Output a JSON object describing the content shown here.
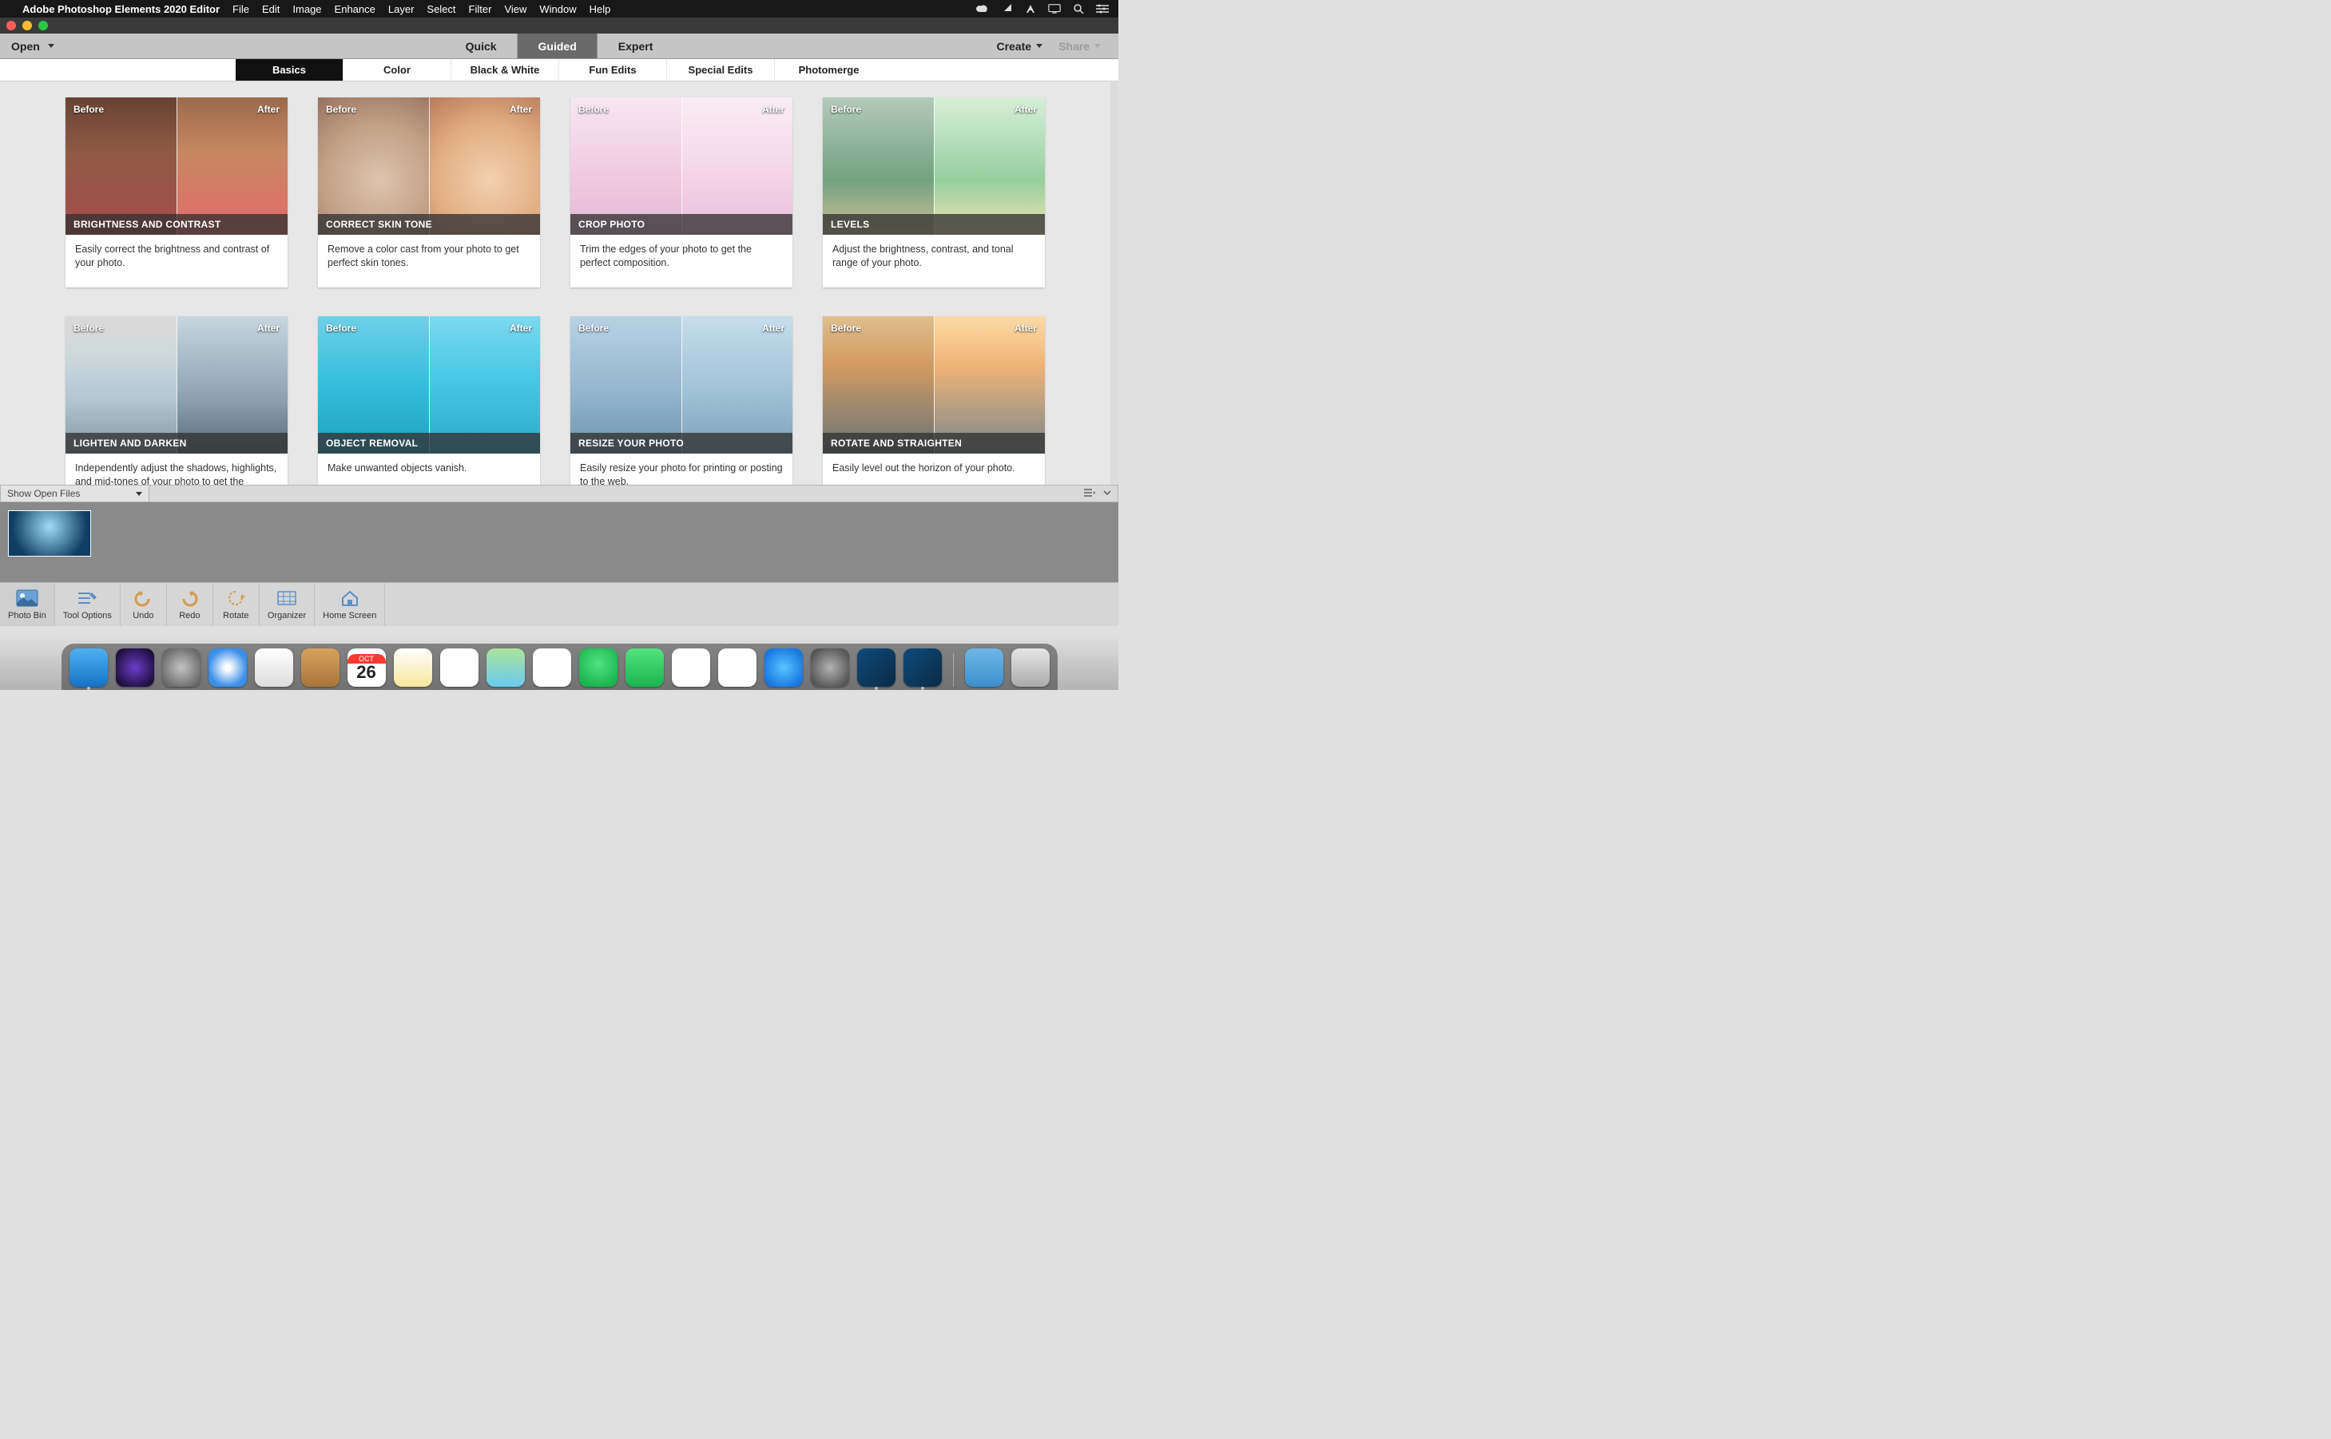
{
  "menubar": {
    "app_name": "Adobe Photoshop Elements 2020 Editor",
    "items": [
      "File",
      "Edit",
      "Image",
      "Enhance",
      "Layer",
      "Select",
      "Filter",
      "View",
      "Window",
      "Help"
    ]
  },
  "toolbar": {
    "open_label": "Open",
    "modes": [
      {
        "label": "Quick",
        "active": false
      },
      {
        "label": "Guided",
        "active": true
      },
      {
        "label": "Expert",
        "active": false
      }
    ],
    "create_label": "Create",
    "share_label": "Share"
  },
  "categories": [
    {
      "label": "Basics",
      "active": true
    },
    {
      "label": "Color",
      "active": false
    },
    {
      "label": "Black & White",
      "active": false
    },
    {
      "label": "Fun Edits",
      "active": false
    },
    {
      "label": "Special Edits",
      "active": false
    },
    {
      "label": "Photomerge",
      "active": false
    }
  ],
  "ba": {
    "before": "Before",
    "after": "After"
  },
  "cards": [
    {
      "title": "BRIGHTNESS AND CONTRAST",
      "desc": "Easily correct the brightness and contrast of your photo.",
      "artL": "art-bc-left",
      "artR": "art-bc-right"
    },
    {
      "title": "CORRECT SKIN TONE",
      "desc": "Remove a color cast from your photo to get perfect skin tones.",
      "artL": "art-skin-left",
      "artR": "art-skin-right"
    },
    {
      "title": "CROP PHOTO",
      "desc": "Trim the edges of your photo to get the perfect composition.",
      "artL": "art-crop-left",
      "artR": "art-crop-right"
    },
    {
      "title": "LEVELS",
      "desc": "Adjust the brightness, contrast, and tonal range of your photo.",
      "artL": "art-levels-left",
      "artR": "art-levels-right"
    },
    {
      "title": "LIGHTEN AND DARKEN",
      "desc": "Independently adjust the shadows, highlights, and mid-tones of your photo to get the",
      "artL": "art-lighten-left",
      "artR": "art-lighten-right"
    },
    {
      "title": "OBJECT REMOVAL",
      "desc": "Make unwanted objects vanish.",
      "artL": "art-obj-left",
      "artR": "art-obj-right"
    },
    {
      "title": "RESIZE YOUR PHOTO",
      "desc": "Easily resize your photo for printing or posting to the web.",
      "artL": "art-resize-left",
      "artR": "art-resize-right"
    },
    {
      "title": "ROTATE AND STRAIGHTEN",
      "desc": "Easily level out the horizon of your photo.",
      "artL": "art-rotate-left",
      "artR": "art-rotate-right"
    }
  ],
  "bin_header": {
    "dropdown": "Show Open Files"
  },
  "bottom": {
    "photo_bin": "Photo Bin",
    "tool_options": "Tool Options",
    "undo": "Undo",
    "redo": "Redo",
    "rotate": "Rotate",
    "organizer": "Organizer",
    "home_screen": "Home Screen"
  },
  "dock": {
    "calendar_month": "OCT",
    "calendar_day": "26"
  }
}
